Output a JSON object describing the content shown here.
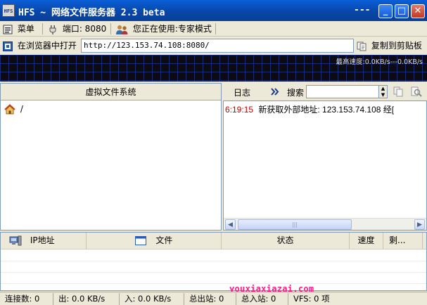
{
  "window": {
    "title": "HFS ~ 网络文件服务器 2.3 beta",
    "title_dashes": "---",
    "icon_label": "HFS",
    "minimize": "_",
    "maximize": "□",
    "close": "✕"
  },
  "toolbar": {
    "menu_label": "菜单",
    "port_label": "端口: 8080",
    "mode_label": "您正在使用:专家模式"
  },
  "addressbar": {
    "open_label": "在浏览器中打开",
    "url": "http://123.153.74.108:8080/",
    "copy_label": "复制到剪贴板"
  },
  "graph": {
    "label": "最高速度:0.0KB/s---0.0KB/s"
  },
  "vfs": {
    "header": "虚拟文件系统",
    "root": "/"
  },
  "log": {
    "tab_label": "日志",
    "search_label": "搜索",
    "search_value": "",
    "entries": [
      {
        "time": "6:19:15",
        "text": "新获取外部地址: 123.153.74.108 经["
      }
    ]
  },
  "connections": {
    "columns": [
      "IP地址",
      "文件",
      "状态",
      "速度",
      "剩..."
    ],
    "rows": []
  },
  "watermark": "youxiaxiazai.com",
  "statusbar": {
    "connections": "连接数: 0",
    "out": "出: 0.0 KB/s",
    "in": "入: 0.0 KB/s",
    "total_out": "总出站: 0",
    "total_in": "总入站: 0",
    "vfs": "VFS: 0 项"
  },
  "colors": {
    "titlebar": "#0847a8",
    "graph_bg": "#0c0c10",
    "graph_grid": "#1a2a7a",
    "log_time": "#c00000",
    "watermark": "#ff1a8c"
  }
}
